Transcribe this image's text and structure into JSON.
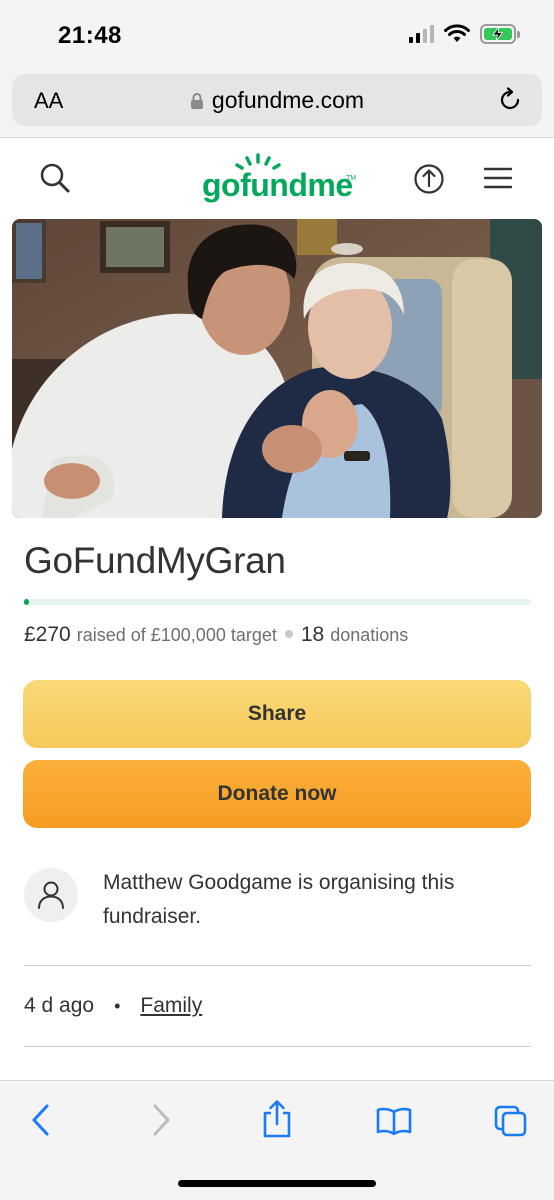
{
  "status_bar": {
    "time": "21:48"
  },
  "browser": {
    "text_size_label": "AA",
    "url": "gofundme.com"
  },
  "site": {
    "logo_text": "gofundme",
    "logo_tm": "TM",
    "brand_color": "#02a95c"
  },
  "campaign": {
    "title": "GoFundMyGran",
    "raised": "£270",
    "raised_text": "raised of £100,000 target",
    "donation_count": "18",
    "donation_label": "donations",
    "progress_fraction": 0.0027,
    "share_label": "Share",
    "donate_label": "Donate now",
    "organiser_text": "Matthew Goodgame is organising this fundraiser.",
    "time_ago": "4 d ago",
    "category": "Family"
  },
  "colors": {
    "share_button": "#f7d16a",
    "donate_button": "#f9a42e",
    "ios_blue": "#1a7cf5"
  }
}
